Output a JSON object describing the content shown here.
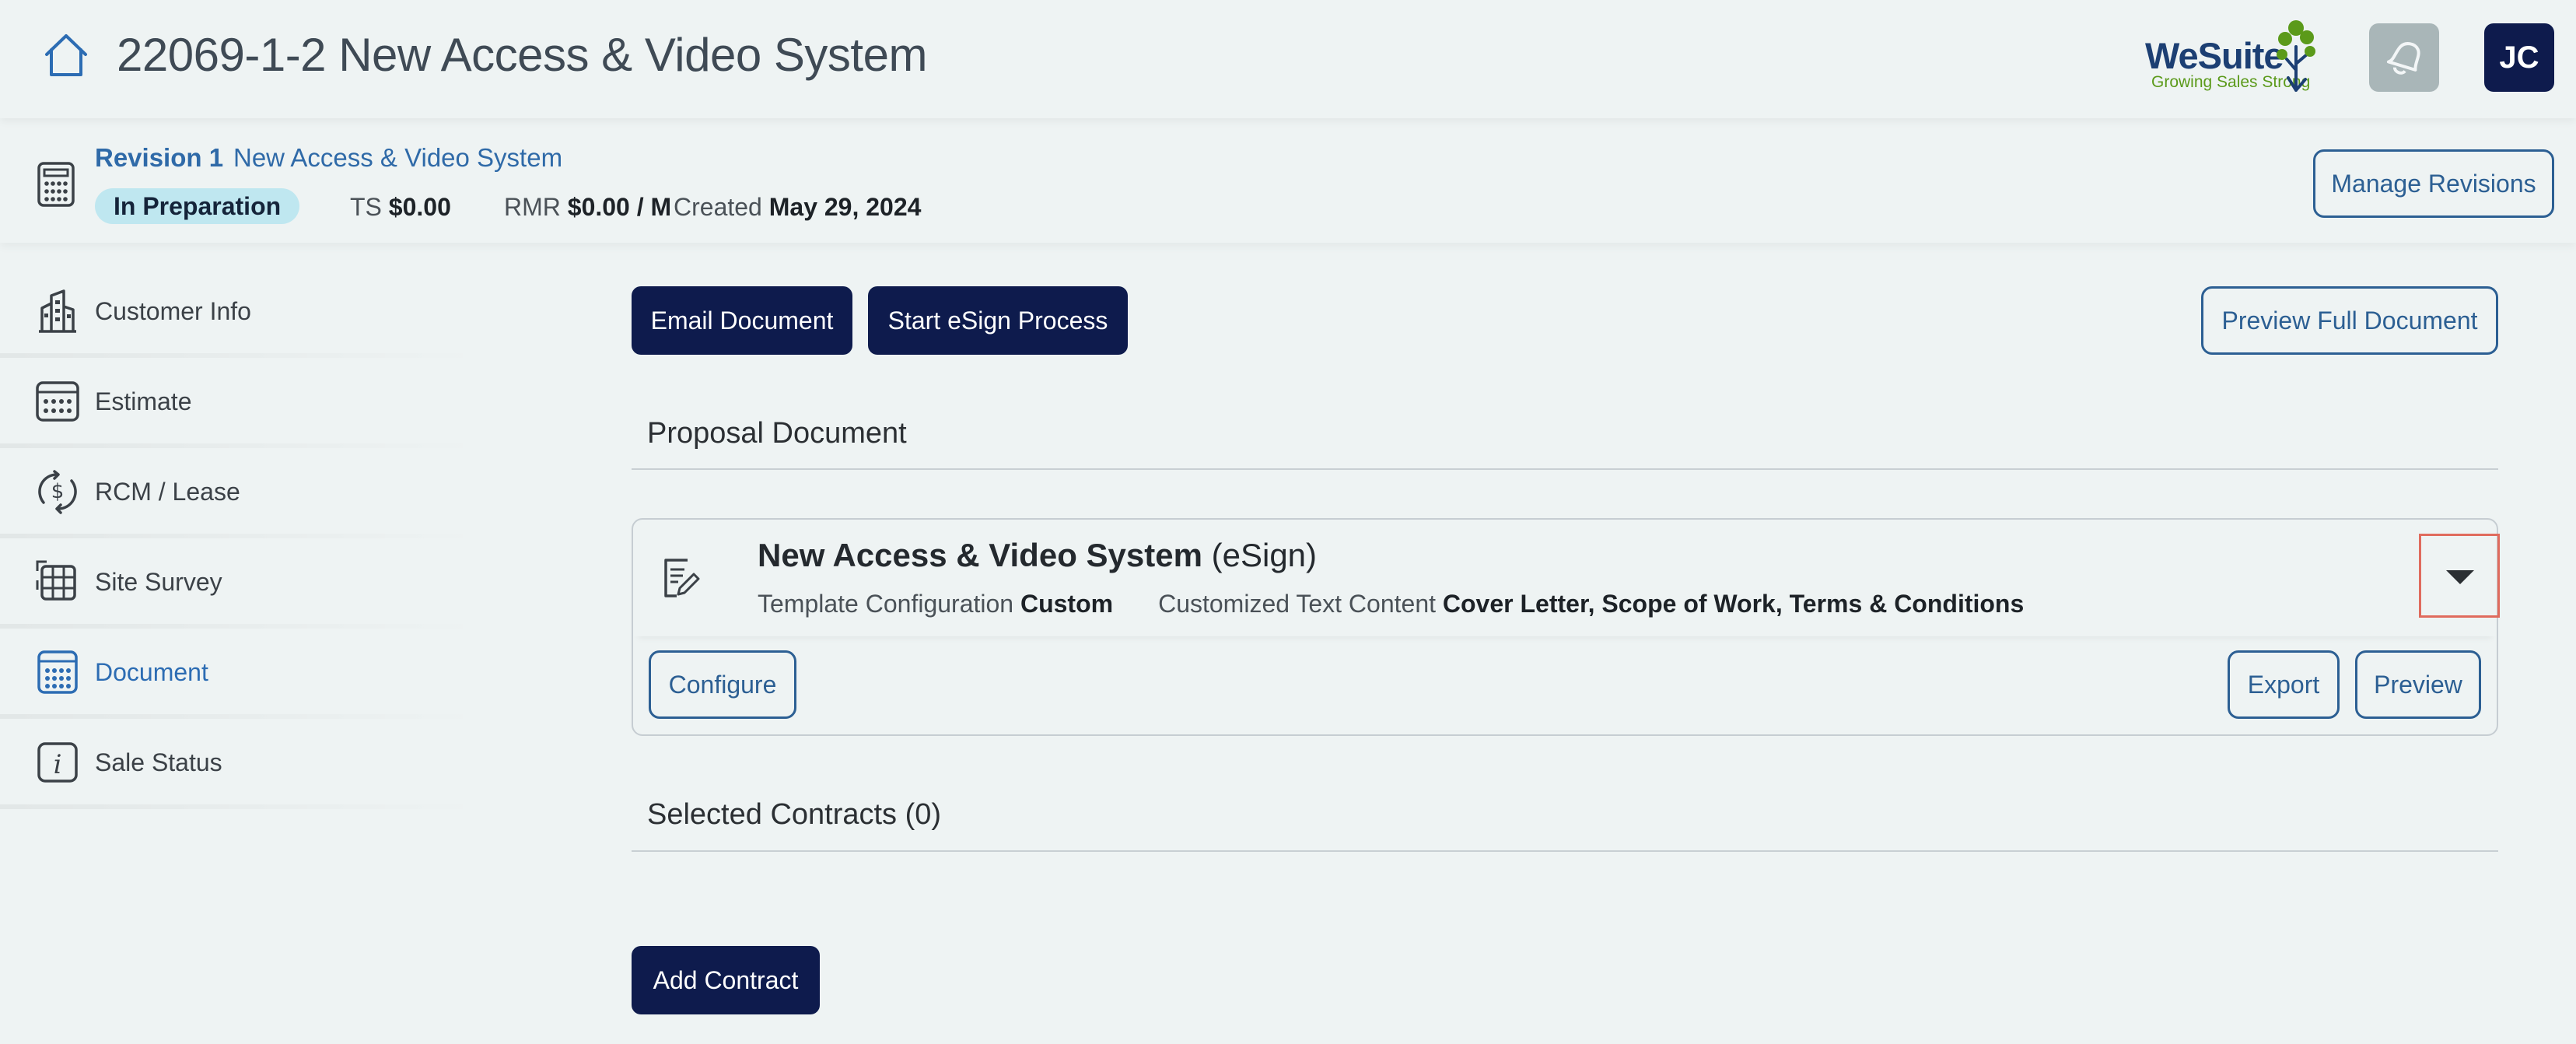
{
  "header": {
    "title": "22069-1-2 New Access & Video System",
    "logo_word": "WeSuite",
    "logo_tagline": "Growing Sales Strong",
    "avatar_initials": "JC"
  },
  "revision": {
    "label": "Revision 1",
    "name": "New Access & Video System",
    "status": "In Preparation",
    "ts_label": "TS",
    "ts_value": "$0.00",
    "rmr_label": "RMR",
    "rmr_value": "$0.00 / M",
    "created_label": "Created",
    "created_value": "May 29, 2024",
    "manage_button": "Manage Revisions"
  },
  "sidebar": {
    "items": [
      {
        "label": "Customer Info",
        "icon": "building-icon",
        "active": false
      },
      {
        "label": "Estimate",
        "icon": "calculator-icon",
        "active": false
      },
      {
        "label": "RCM / Lease",
        "icon": "dollar-cycle-icon",
        "active": false
      },
      {
        "label": "Site Survey",
        "icon": "grid-icon",
        "active": false
      },
      {
        "label": "Document",
        "icon": "document-icon",
        "active": true
      },
      {
        "label": "Sale Status",
        "icon": "info-icon",
        "active": false
      }
    ]
  },
  "main": {
    "email_button": "Email Document",
    "esign_button": "Start eSign Process",
    "preview_full_button": "Preview Full Document",
    "proposal_section_title": "Proposal Document",
    "document": {
      "name": "New Access & Video System",
      "name_suffix": "(eSign)",
      "template_label": "Template Configuration",
      "template_value": "Custom",
      "custom_text_label": "Customized Text Content",
      "custom_text_value": "Cover Letter, Scope of Work, Terms & Conditions",
      "configure_button": "Configure",
      "export_button": "Export",
      "preview_button": "Preview"
    },
    "contracts_section_title": "Selected Contracts (0)",
    "add_contract_button": "Add Contract"
  },
  "colors": {
    "background": "#eef3f3",
    "navy": "#0e1b4d",
    "link_blue": "#2c5f93",
    "active_blue": "#2c6cb3",
    "status_badge": "#bfe7f0",
    "highlight_border": "#e06b5d"
  }
}
